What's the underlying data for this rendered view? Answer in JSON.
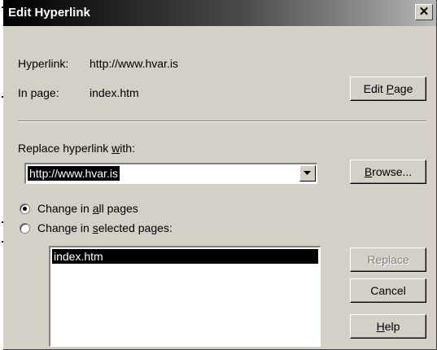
{
  "dialog": {
    "title": "Edit Hyperlink",
    "close_glyph": "✕"
  },
  "hyperlink": {
    "label": "Hyperlink:",
    "value": "http://www.hvar.is"
  },
  "in_page": {
    "label": "In page:",
    "value": "index.htm"
  },
  "buttons": {
    "edit_page_pre": "Edit ",
    "edit_page_key": "P",
    "edit_page_post": "age",
    "browse_key": "B",
    "browse_post": "rowse...",
    "replace": "Replace",
    "cancel": "Cancel",
    "help_key": "H",
    "help_post": "elp"
  },
  "replace_with": {
    "label_pre": "Replace hyperlink ",
    "label_key": "w",
    "label_post": "ith:",
    "value": "http://www.hvar.is"
  },
  "options": {
    "all_pre": "Change in ",
    "all_key": "a",
    "all_post": "ll pages",
    "selected_pre": "Change in ",
    "selected_key": "s",
    "selected_post": "elected pages:",
    "selected_option": "all"
  },
  "pages": [
    "index.htm"
  ],
  "icons": {
    "close": "close-icon",
    "dropdown": "chevron-down-icon"
  }
}
